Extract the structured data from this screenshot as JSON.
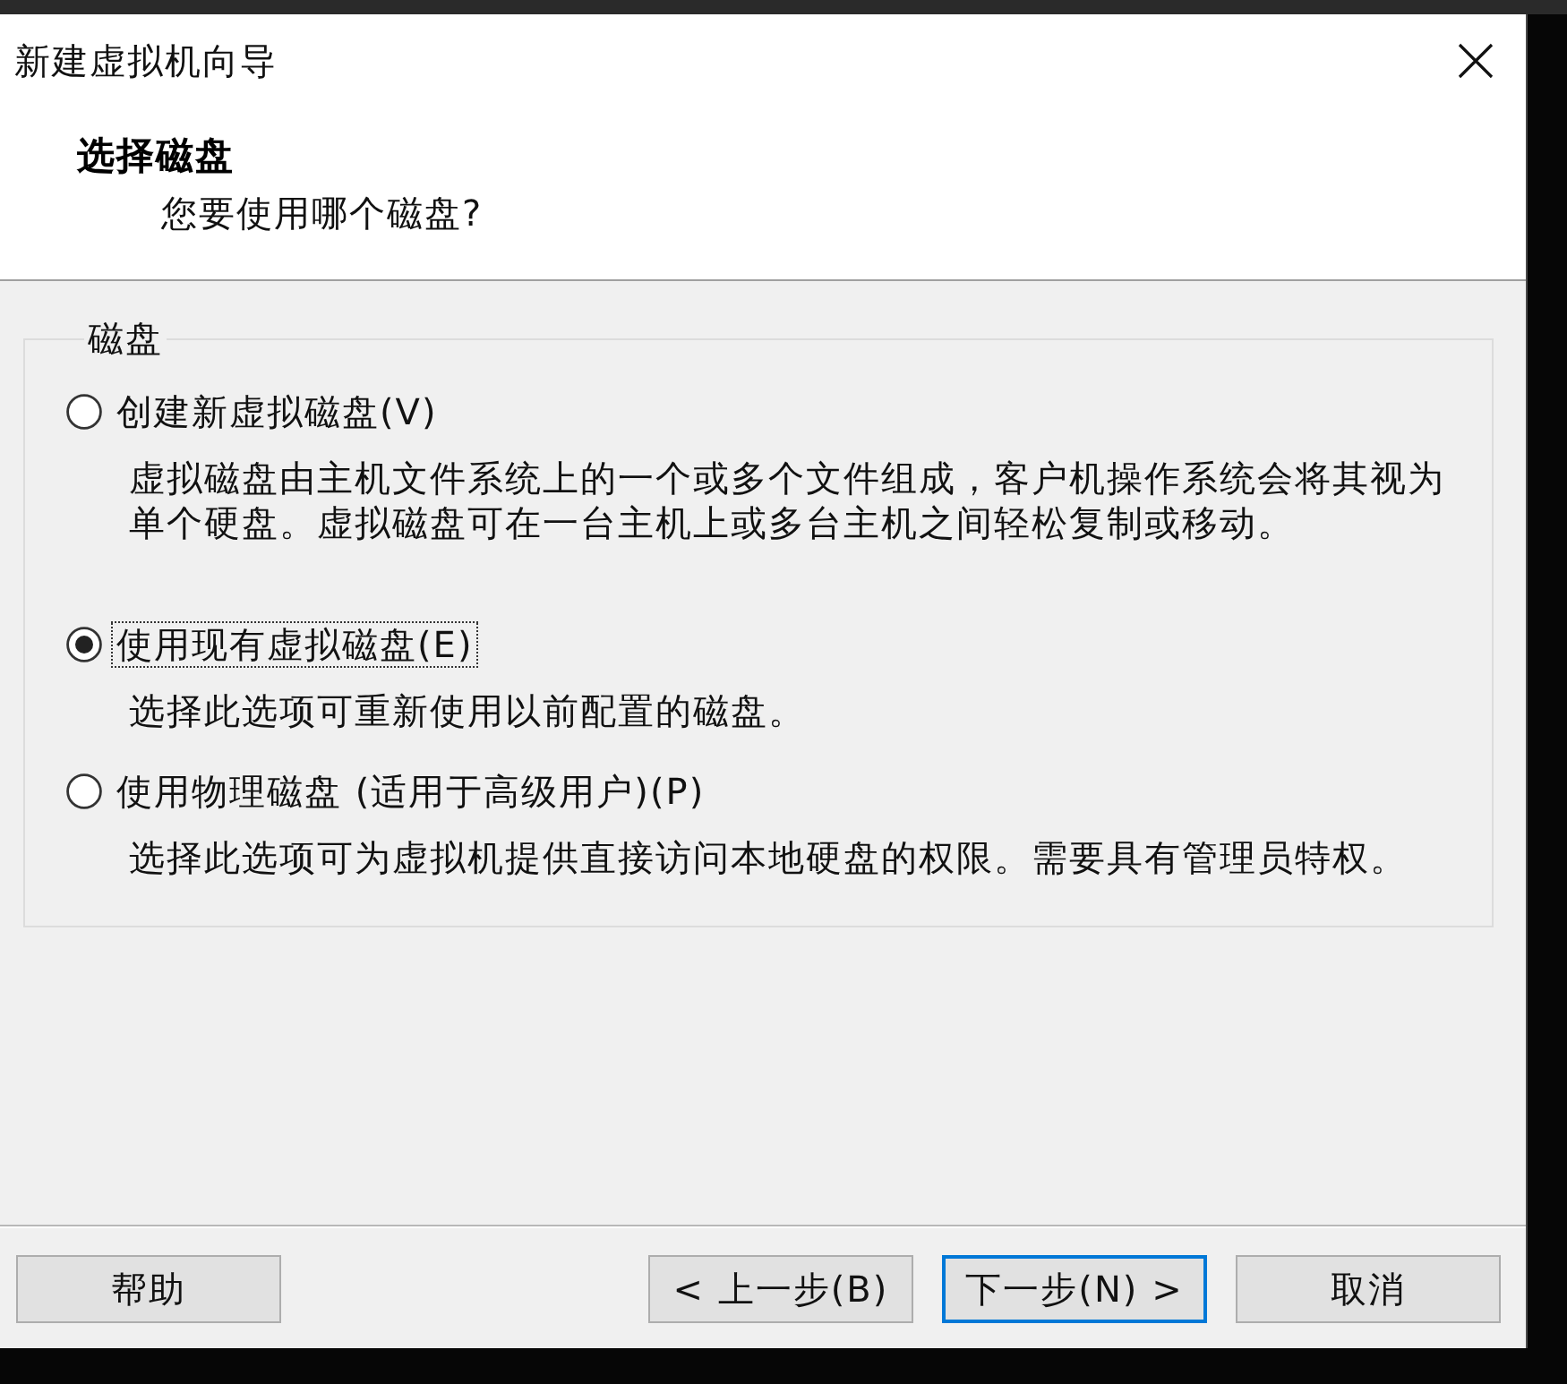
{
  "window": {
    "title": "新建虚拟机向导"
  },
  "header": {
    "title": "选择磁盘",
    "subtitle": "您要使用哪个磁盘?"
  },
  "disk_group": {
    "label": "磁盘",
    "options": [
      {
        "label": "创建新虚拟磁盘(V)",
        "description": "虚拟磁盘由主机文件系统上的一个或多个文件组成，客户机操作系统会将其视为单个硬盘。虚拟磁盘可在一台主机上或多台主机之间轻松复制或移动。",
        "selected": false,
        "focused": false
      },
      {
        "label": "使用现有虚拟磁盘(E)",
        "description": "选择此选项可重新使用以前配置的磁盘。",
        "selected": true,
        "focused": true
      },
      {
        "label": "使用物理磁盘 (适用于高级用户)(P)",
        "description": "选择此选项可为虚拟机提供直接访问本地硬盘的权限。需要具有管理员特权。",
        "selected": false,
        "focused": false
      }
    ]
  },
  "buttons": [
    {
      "label": "帮助",
      "default": false
    },
    {
      "label": "< 上一步(B)",
      "default": false
    },
    {
      "label": "下一步(N) >",
      "default": true
    },
    {
      "label": "取消",
      "default": false
    }
  ]
}
